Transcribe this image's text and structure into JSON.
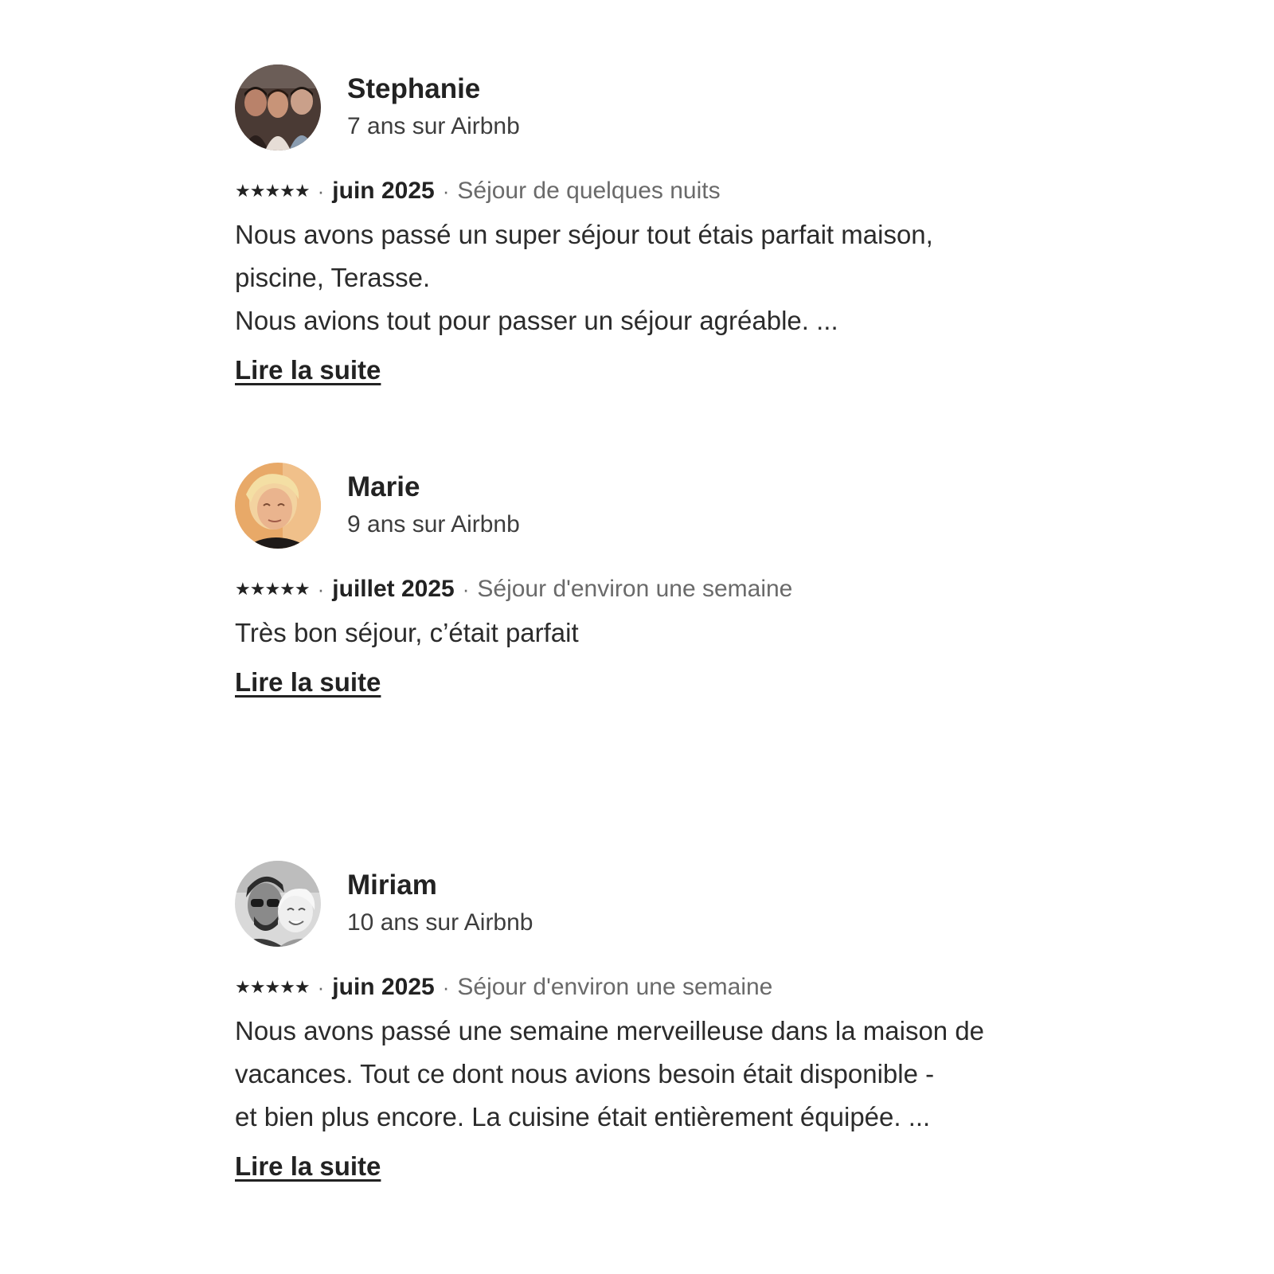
{
  "reviews": [
    {
      "name": "Stephanie",
      "tenure": "7 ans sur Airbnb",
      "rating": 5,
      "stars": "★★★★★",
      "separator": "·",
      "date": "juin 2025",
      "stay": "Séjour de quelques nuits",
      "text": "Nous avons passé un super séjour tout étais parfait maison,\npiscine, Terasse.\nNous avions tout pour passer un séjour agréable. ...",
      "read_more": "Lire la suite"
    },
    {
      "name": "Marie",
      "tenure": "9 ans sur Airbnb",
      "rating": 5,
      "stars": "★★★★★",
      "separator": "·",
      "date": "juillet 2025",
      "stay": "Séjour d'environ une semaine",
      "text": "Très bon séjour, c’était parfait",
      "read_more": "Lire la suite"
    },
    {
      "name": "Miriam",
      "tenure": "10 ans sur Airbnb",
      "rating": 5,
      "stars": "★★★★★",
      "separator": "·",
      "date": "juin 2025",
      "stay": "Séjour d'environ une semaine",
      "text": "Nous avons passé une semaine merveilleuse dans la maison de\nvacances. Tout ce dont nous avions besoin était disponible -\net bien plus encore. La cuisine était entièrement équipée. ...",
      "read_more": "Lire la suite"
    }
  ]
}
